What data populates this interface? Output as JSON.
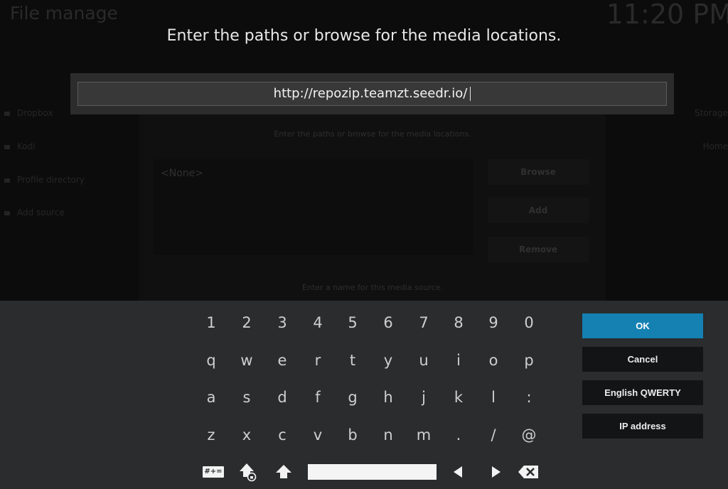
{
  "background": {
    "title": "File manage",
    "clock": "11:20 PM",
    "sidebar_items": [
      "Dropbox",
      "Kodi",
      "Profile directory",
      "Add source"
    ],
    "right_items": [
      "Storage",
      "Home"
    ],
    "dialog": {
      "prompt": "Enter the paths or browse for the media locations.",
      "list_item": "<None>",
      "buttons": [
        "Browse",
        "Add",
        "Remove"
      ],
      "name_prompt": "Enter a name for this media source."
    }
  },
  "keyboard_dialog": {
    "heading": "Enter the paths or browse for the media locations.",
    "input_value": "http://repozip.teamzt.seedr.io/"
  },
  "keyboard": {
    "rows": [
      [
        "1",
        "2",
        "3",
        "4",
        "5",
        "6",
        "7",
        "8",
        "9",
        "0"
      ],
      [
        "q",
        "w",
        "e",
        "r",
        "t",
        "y",
        "u",
        "i",
        "o",
        "p"
      ],
      [
        "a",
        "s",
        "d",
        "f",
        "g",
        "h",
        "j",
        "k",
        "l",
        ":"
      ],
      [
        "z",
        "x",
        "c",
        "v",
        "b",
        "n",
        "m",
        ".",
        "/",
        "@"
      ]
    ],
    "symbols_label": "#+=",
    "icons": [
      "shift-lock-icon",
      "shift-icon",
      "space-bar",
      "left-arrow-icon",
      "right-arrow-icon",
      "backspace-icon"
    ]
  },
  "buttons": {
    "ok": "OK",
    "cancel": "Cancel",
    "layout": "English QWERTY",
    "ip": "IP address"
  },
  "colors": {
    "accent": "#1581b3",
    "keyboard_bg": "#2a2c2d",
    "button_bg": "#121415"
  }
}
